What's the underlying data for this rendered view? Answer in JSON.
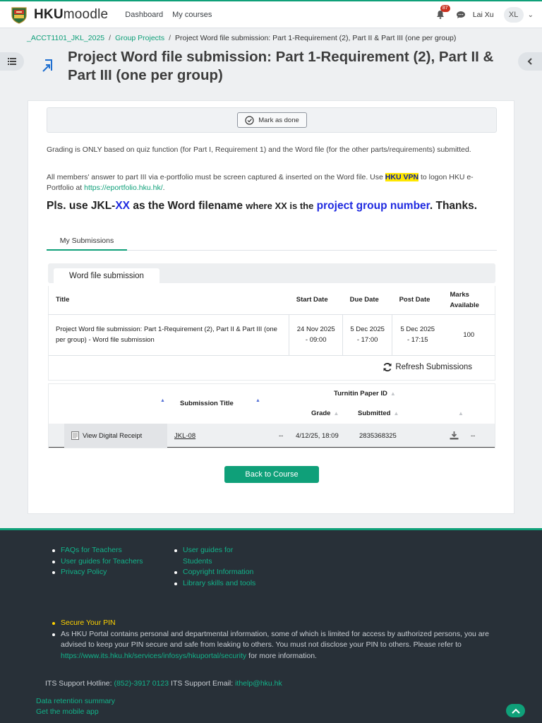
{
  "header": {
    "brand_prefix": "HKU",
    "brand_suffix": "moodle",
    "nav": [
      "Dashboard",
      "My courses"
    ],
    "notification_count": "87",
    "user_name": "Lai Xu",
    "user_initials": "XL"
  },
  "breadcrumb": {
    "items": [
      "_ACCT1101_JKL_2025",
      "Group Projects"
    ],
    "current": "Project Word file submission: Part 1-Requirement (2), Part II & Part III (one per group)"
  },
  "page_title": "Project Word file submission: Part 1-Requirement (2), Part II & Part III (one per group)",
  "completion": {
    "mark_done_label": "Mark as done"
  },
  "description": {
    "p1": "Grading is ONLY based on quiz function (for Part I, Requirement 1) and the Word file (for the other parts/requirements) submitted.",
    "p2_before": "All members' answer to part III via e-portfolio must be screen captured & inserted on the Word file.  Use ",
    "p2_highlight": "HKU VPN",
    "p2_middle": " to logon HKU e-Portfolio at ",
    "p2_link": "https://eportfolio.hku.hk/",
    "p2_after": ".",
    "big_1": "Pls. use JKL-",
    "big_xx": "XX",
    "big_2": " as the Word filename ",
    "big_small": "where XX is the",
    "big_3": " ",
    "big_blue": "project group number",
    "big_4": ".  Thanks."
  },
  "tabs": {
    "my_submissions": "My Submissions"
  },
  "panel": {
    "tab_label": "Word file submission",
    "info_headers": [
      "Title",
      "Start Date",
      "Due Date",
      "Post Date",
      "Marks Available"
    ],
    "info_row": {
      "title": "Project Word file submission: Part 1-Requirement (2), Part II & Part III (one per group) - Word file submission",
      "start": "24 Nov 2025 - 09:00",
      "due": "5 Dec 2025 - 17:00",
      "post": "5 Dec 2025 - 17:15",
      "marks": "100"
    },
    "refresh_label": "Refresh Submissions"
  },
  "submissions": {
    "headers": {
      "submission_title": "Submission Title",
      "turnitin_id": "Turnitin Paper ID",
      "grade": "Grade",
      "submitted": "Submitted"
    },
    "row": {
      "receipt": "View Digital Receipt",
      "title": "JKL-08",
      "dash1": "--",
      "submitted": "4/12/25, 18:09",
      "paper_id": "2835368325",
      "dash2": "--"
    }
  },
  "back_button": "Back to Course",
  "footer": {
    "col1": [
      "FAQs for Teachers",
      "User guides for Teachers",
      "Privacy Policy"
    ],
    "col2": [
      "User guides for Students",
      "Copyright Information",
      "Library skills and tools"
    ],
    "secure_pin": "Secure Your PIN",
    "notice_before": "As HKU Portal contains personal and departmental information, some of which is limited for access by authorized persons, you are advised to keep your PIN secure and safe from leaking to others. You must not disclose your PIN to others. Please refer to ",
    "notice_link": "https://www.its.hku.hk/services/infosys/hkuportal/security",
    "notice_after": " for more information.",
    "hotline_label": "ITS Support Hotline: ",
    "hotline": "(852)-3917 0123",
    "email_label": " ITS Support Email: ",
    "email": "ithelp@hku.hk",
    "data_retention": "Data retention summary",
    "mobile_app": "Get the mobile app"
  },
  "colors": {
    "accent": "#0fa079",
    "footer_bg": "#283038",
    "highlight": "#ffe700"
  }
}
